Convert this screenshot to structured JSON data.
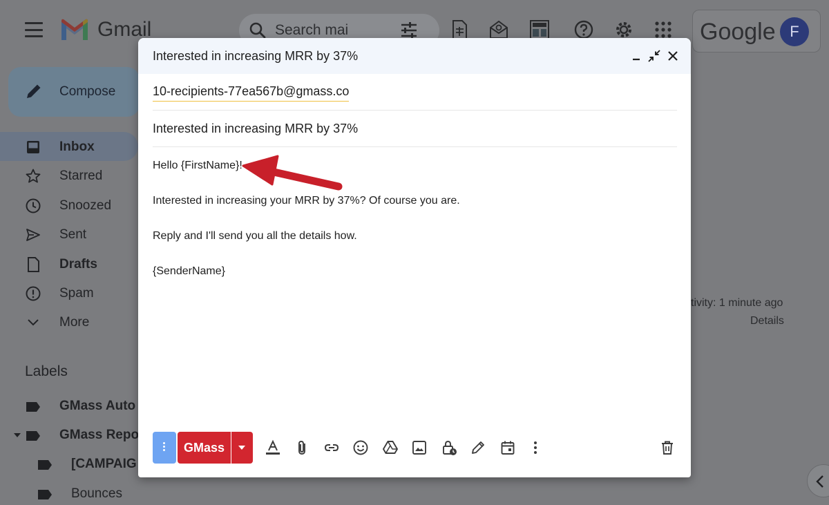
{
  "app": {
    "name": "Gmail",
    "google_word": "Google",
    "avatar_initial": "F"
  },
  "search": {
    "placeholder": "Search mai"
  },
  "compose_button": {
    "label": "Compose"
  },
  "nav": {
    "items": [
      {
        "label": "Inbox",
        "icon": "inbox-icon",
        "active": true,
        "bold": true
      },
      {
        "label": "Starred",
        "icon": "star-icon"
      },
      {
        "label": "Snoozed",
        "icon": "clock-icon"
      },
      {
        "label": "Sent",
        "icon": "send-icon"
      },
      {
        "label": "Drafts",
        "icon": "draft-icon",
        "bold": true
      },
      {
        "label": "Spam",
        "icon": "spam-icon"
      },
      {
        "label": "More",
        "icon": "chevron-down-icon"
      }
    ]
  },
  "labels": {
    "header": "Labels",
    "items": [
      {
        "label": "GMass Auto",
        "bold": true
      },
      {
        "label": "GMass Repo",
        "bold": true,
        "expanded": true
      },
      {
        "label": "[CAMPAIG",
        "bold": true
      },
      {
        "label": "Bounces"
      }
    ]
  },
  "background_right": {
    "activity": "tivity: 1 minute ago",
    "details": "Details"
  },
  "compose": {
    "title": "Interested in increasing MRR by 37%",
    "to": "10-recipients-77ea567b@gmass.co",
    "subject": "Interested in increasing MRR by 37%",
    "body": [
      "Hello {FirstName}!",
      "Interested in increasing your MRR by 37%? Of course you are.",
      "Reply and I'll send you all the details how.",
      "{SenderName}"
    ],
    "send_label": "GMass"
  },
  "colors": {
    "send_button": "#d2262f",
    "options_button": "#6ea4f2",
    "annotation_arrow": "#c8202a"
  }
}
